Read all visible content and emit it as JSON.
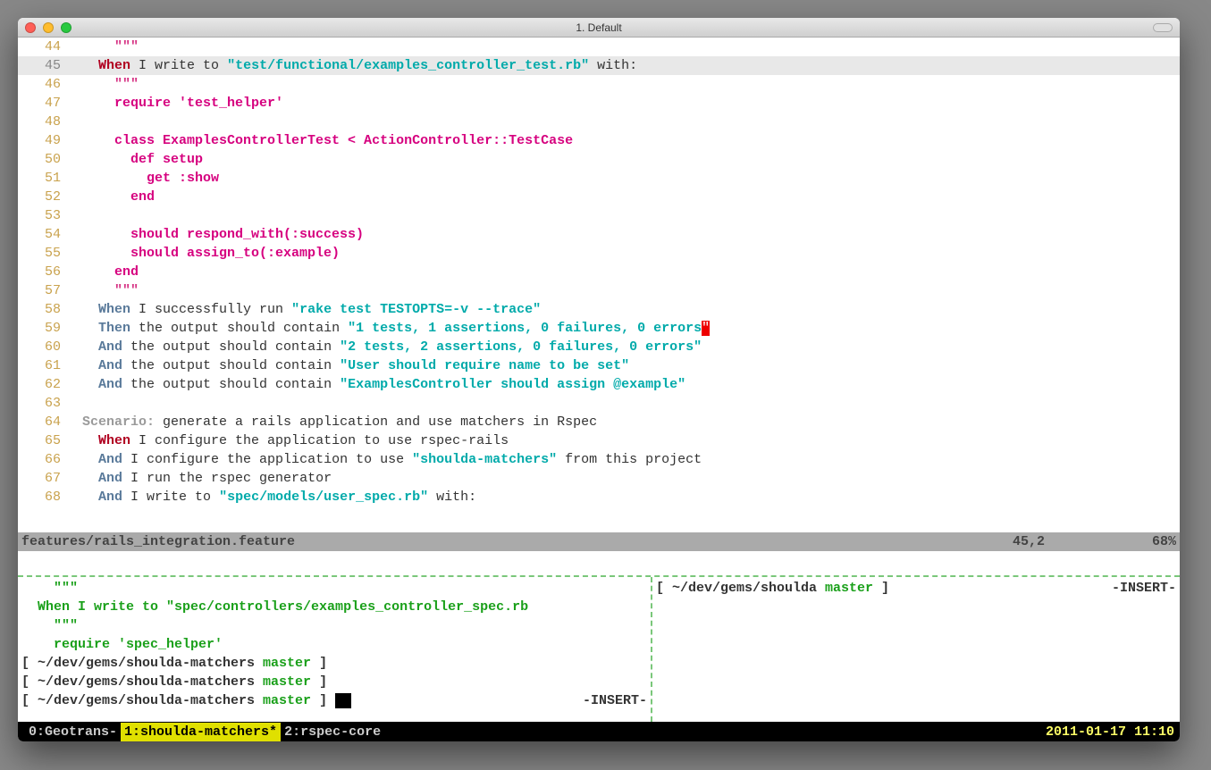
{
  "window": {
    "title": "1. Default"
  },
  "editor": {
    "lines": [
      {
        "n": 44,
        "hl": false,
        "segs": [
          {
            "t": "      ",
            "c": ""
          },
          {
            "t": "\"\"\"",
            "c": "str"
          }
        ]
      },
      {
        "n": 45,
        "hl": true,
        "segs": [
          {
            "t": "    ",
            "c": ""
          },
          {
            "t": "When",
            "c": "kw-when"
          },
          {
            "t": " I write to ",
            "c": "blk"
          },
          {
            "t": "\"test/functional/examples_controller_test.rb\"",
            "c": "str2"
          },
          {
            "t": " with:",
            "c": "blk"
          }
        ]
      },
      {
        "n": 46,
        "hl": false,
        "segs": [
          {
            "t": "      ",
            "c": ""
          },
          {
            "t": "\"\"\"",
            "c": "str"
          }
        ]
      },
      {
        "n": 47,
        "hl": false,
        "segs": [
          {
            "t": "      ",
            "c": ""
          },
          {
            "t": "require 'test_helper'",
            "c": "magenta"
          }
        ]
      },
      {
        "n": 48,
        "hl": false,
        "segs": [
          {
            "t": " ",
            "c": ""
          }
        ]
      },
      {
        "n": 49,
        "hl": false,
        "segs": [
          {
            "t": "      ",
            "c": ""
          },
          {
            "t": "class ExamplesControllerTest < ActionController::TestCase",
            "c": "magenta"
          }
        ]
      },
      {
        "n": 50,
        "hl": false,
        "segs": [
          {
            "t": "        ",
            "c": ""
          },
          {
            "t": "def setup",
            "c": "magenta"
          }
        ]
      },
      {
        "n": 51,
        "hl": false,
        "segs": [
          {
            "t": "          ",
            "c": ""
          },
          {
            "t": "get :show",
            "c": "magenta"
          }
        ]
      },
      {
        "n": 52,
        "hl": false,
        "segs": [
          {
            "t": "        ",
            "c": ""
          },
          {
            "t": "end",
            "c": "magenta"
          }
        ]
      },
      {
        "n": 53,
        "hl": false,
        "segs": [
          {
            "t": " ",
            "c": ""
          }
        ]
      },
      {
        "n": 54,
        "hl": false,
        "segs": [
          {
            "t": "        ",
            "c": ""
          },
          {
            "t": "should respond_with(:success)",
            "c": "magenta"
          }
        ]
      },
      {
        "n": 55,
        "hl": false,
        "segs": [
          {
            "t": "        ",
            "c": ""
          },
          {
            "t": "should assign_to(:example)",
            "c": "magenta"
          }
        ]
      },
      {
        "n": 56,
        "hl": false,
        "segs": [
          {
            "t": "      ",
            "c": ""
          },
          {
            "t": "end",
            "c": "magenta"
          }
        ]
      },
      {
        "n": 57,
        "hl": false,
        "segs": [
          {
            "t": "      ",
            "c": ""
          },
          {
            "t": "\"\"\"",
            "c": "str"
          }
        ]
      },
      {
        "n": 58,
        "hl": false,
        "segs": [
          {
            "t": "    ",
            "c": ""
          },
          {
            "t": "When",
            "c": "kw-sub"
          },
          {
            "t": " I successfully run ",
            "c": "blk"
          },
          {
            "t": "\"rake test TESTOPTS=-v --trace\"",
            "c": "str2"
          }
        ]
      },
      {
        "n": 59,
        "hl": false,
        "segs": [
          {
            "t": "    ",
            "c": ""
          },
          {
            "t": "Then",
            "c": "kw-then"
          },
          {
            "t": " the output should contain ",
            "c": "blk"
          },
          {
            "t": "\"1 tests, 1 assertions, 0 failures, 0 errors",
            "c": "str2"
          },
          {
            "t": "\"",
            "c": "cursor-red"
          }
        ]
      },
      {
        "n": 60,
        "hl": false,
        "segs": [
          {
            "t": "    ",
            "c": ""
          },
          {
            "t": "And",
            "c": "kw-and"
          },
          {
            "t": " the output should contain ",
            "c": "blk"
          },
          {
            "t": "\"2 tests, 2 assertions, 0 failures, 0 errors\"",
            "c": "str2"
          }
        ]
      },
      {
        "n": 61,
        "hl": false,
        "segs": [
          {
            "t": "    ",
            "c": ""
          },
          {
            "t": "And",
            "c": "kw-and"
          },
          {
            "t": " the output should contain ",
            "c": "blk"
          },
          {
            "t": "\"User should require name to be set\"",
            "c": "str2"
          }
        ]
      },
      {
        "n": 62,
        "hl": false,
        "segs": [
          {
            "t": "    ",
            "c": ""
          },
          {
            "t": "And",
            "c": "kw-and"
          },
          {
            "t": " the output should contain ",
            "c": "blk"
          },
          {
            "t": "\"ExamplesController should assign @example\"",
            "c": "str2"
          }
        ]
      },
      {
        "n": 63,
        "hl": false,
        "segs": [
          {
            "t": " ",
            "c": ""
          }
        ]
      },
      {
        "n": 64,
        "hl": false,
        "segs": [
          {
            "t": "  ",
            "c": ""
          },
          {
            "t": "Scenario:",
            "c": "kw-scenario"
          },
          {
            "t": " generate a rails application and use matchers in Rspec",
            "c": "blk"
          }
        ]
      },
      {
        "n": 65,
        "hl": false,
        "segs": [
          {
            "t": "    ",
            "c": ""
          },
          {
            "t": "When",
            "c": "kw-when"
          },
          {
            "t": " I configure the application to use rspec-rails",
            "c": "blk"
          }
        ]
      },
      {
        "n": 66,
        "hl": false,
        "segs": [
          {
            "t": "    ",
            "c": ""
          },
          {
            "t": "And",
            "c": "kw-and"
          },
          {
            "t": " I configure the application to use ",
            "c": "blk"
          },
          {
            "t": "\"shoulda-matchers\"",
            "c": "str2"
          },
          {
            "t": " from this project",
            "c": "blk"
          }
        ]
      },
      {
        "n": 67,
        "hl": false,
        "segs": [
          {
            "t": "    ",
            "c": ""
          },
          {
            "t": "And",
            "c": "kw-and"
          },
          {
            "t": " I run the rspec generator",
            "c": "blk"
          }
        ]
      },
      {
        "n": 68,
        "hl": false,
        "segs": [
          {
            "t": "    ",
            "c": ""
          },
          {
            "t": "And",
            "c": "kw-and"
          },
          {
            "t": " I write to ",
            "c": "blk"
          },
          {
            "t": "\"spec/models/user_spec.rb\"",
            "c": "str2"
          },
          {
            "t": " with:",
            "c": "blk"
          }
        ]
      }
    ]
  },
  "status": {
    "filename": "features/rails_integration.feature",
    "pos": "45,2",
    "pct": "68%"
  },
  "lower_left": {
    "lines": [
      {
        "segs": [
          {
            "t": "    \"\"\"",
            "c": "green"
          }
        ]
      },
      {
        "segs": [
          {
            "t": "  When I write to ",
            "c": "green"
          },
          {
            "t": "\"spec/controllers/examples_controller_spec.rb",
            "c": "green"
          }
        ]
      },
      {
        "segs": [
          {
            "t": "    \"\"\"",
            "c": "green"
          }
        ]
      },
      {
        "segs": [
          {
            "t": "    require 'spec_helper'",
            "c": "green"
          }
        ]
      }
    ],
    "prompts": [
      {
        "path": "[ ~/dev/gems/shoulda-matchers ",
        "branch": "master",
        "end": " ]"
      },
      {
        "path": "[ ~/dev/gems/shoulda-matchers ",
        "branch": "master",
        "end": " ]"
      },
      {
        "path": "[ ~/dev/gems/shoulda-matchers ",
        "branch": "master",
        "end": " ] ",
        "cursor": true,
        "right": "-INSERT-"
      }
    ]
  },
  "lower_right": {
    "prompt": {
      "path": "[ ~/dev/gems/shoulda ",
      "branch": "master",
      "end": " ]"
    },
    "right": "-INSERT-"
  },
  "tmux": {
    "tabs": [
      {
        "label": "0:Geotrans-",
        "active": false
      },
      {
        "label": "1:shoulda-matchers*",
        "active": true
      },
      {
        "label": "2:rspec-core",
        "active": false
      }
    ],
    "time": "2011-01-17 11:10"
  }
}
